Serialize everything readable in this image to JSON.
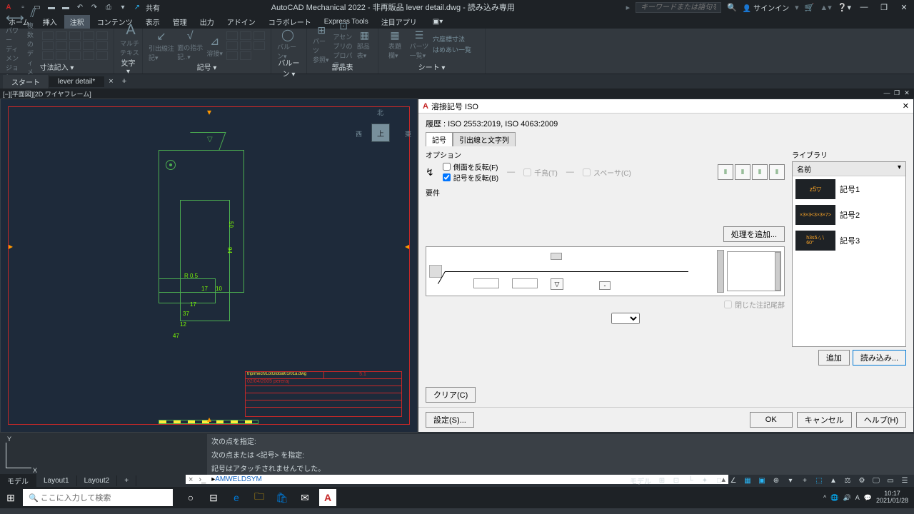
{
  "app": {
    "title": "AutoCAD Mechanical 2022 - 非再販品    lever detail.dwg - 読み込み専用",
    "search_placeholder": "キーワードまたは語句を入力",
    "signin": "サインイン",
    "share": "共有"
  },
  "menubar": [
    "ホーム",
    "挿入",
    "注釈",
    "コンテンツ",
    "表示",
    "管理",
    "出力",
    "アドイン",
    "コラボレート",
    "Express Tools",
    "注目アプリ"
  ],
  "menubar_active": 2,
  "ribbon_panels": [
    {
      "label": "寸法記入 ▾",
      "big": [
        "パワー\nディメンジョン",
        "複数の\nディメン..."
      ]
    },
    {
      "label": "文字 ▾",
      "big": [
        "マルチ\nテキスト"
      ]
    },
    {
      "label": "記号 ▾",
      "big": [
        "引出線注記▾",
        "面の指示記..▾",
        "溶接▾"
      ]
    },
    {
      "label": "バルーン ▾",
      "big": [
        "バルーン▾"
      ]
    },
    {
      "label": "部品表",
      "big": [
        "パーツ\n参照▾",
        "アセンブリの\nプロパティ",
        "部品表▾"
      ]
    },
    {
      "label": "シート ▾",
      "big": [
        "表題\n欄▾",
        "パーツ\n一覧▾"
      ],
      "extra": [
        "穴座標寸法",
        "はめあい一覧"
      ]
    }
  ],
  "filetabs": [
    {
      "label": "スタート",
      "active": false
    },
    {
      "label": "lever detail*",
      "active": true
    }
  ],
  "viewport_label": "[−][平面図][2D ワイヤフレーム]",
  "viewcube": {
    "top": "上",
    "n": "北",
    "e": "東",
    "w": "西"
  },
  "dims": {
    "d1": "17",
    "d2": "37",
    "d3": "12",
    "d4": "47",
    "d5": "50",
    "d6": "94",
    "r": "R 0.5",
    "a1": "17",
    "a2": "10"
  },
  "titleblock": {
    "l1": "02/04/2005  pereraj",
    "l2": "5.1"
  },
  "dialog": {
    "title": "溶接記号 ISO",
    "history": "履歴 : ISO 2553:2019, ISO 4063:2009",
    "tab1": "記号",
    "tab2": "引出線と文字列",
    "options": "オプション",
    "chk1": "側面を反転(F)",
    "chk2": "記号を反転(B)",
    "chk3": "千鳥(T)",
    "chk4": "スペーサ(C)",
    "req": "要件",
    "process": "処理を追加...",
    "closed_tail": "閉じた注記尾部",
    "library": "ライブラリ",
    "lib_col": "名前",
    "lib_items": [
      "記号1",
      "記号2",
      "記号3"
    ],
    "lib_thumbs": [
      "z5▽",
      "×3×3<3×3×7>",
      "h3s5 ∕₂∖\n60°"
    ],
    "clear": "クリア(C)",
    "add": "追加",
    "load": "読み込み...",
    "settings": "設定(S)...",
    "ok": "OK",
    "cancel": "キャンセル",
    "help": "ヘルプ(H)"
  },
  "cmd": {
    "h1": "次の点を指定:",
    "h2": "次の点または <記号> を指定:",
    "h3": "記号はアタッチされませんでした。",
    "prompt": "AMWELDSYM"
  },
  "layouts": [
    "モデル",
    "Layout1",
    "Layout2"
  ],
  "status_left": "モデル",
  "taskbar": {
    "search": "ここに入力して検索",
    "time": "10:17",
    "date": "2021/01/28"
  }
}
